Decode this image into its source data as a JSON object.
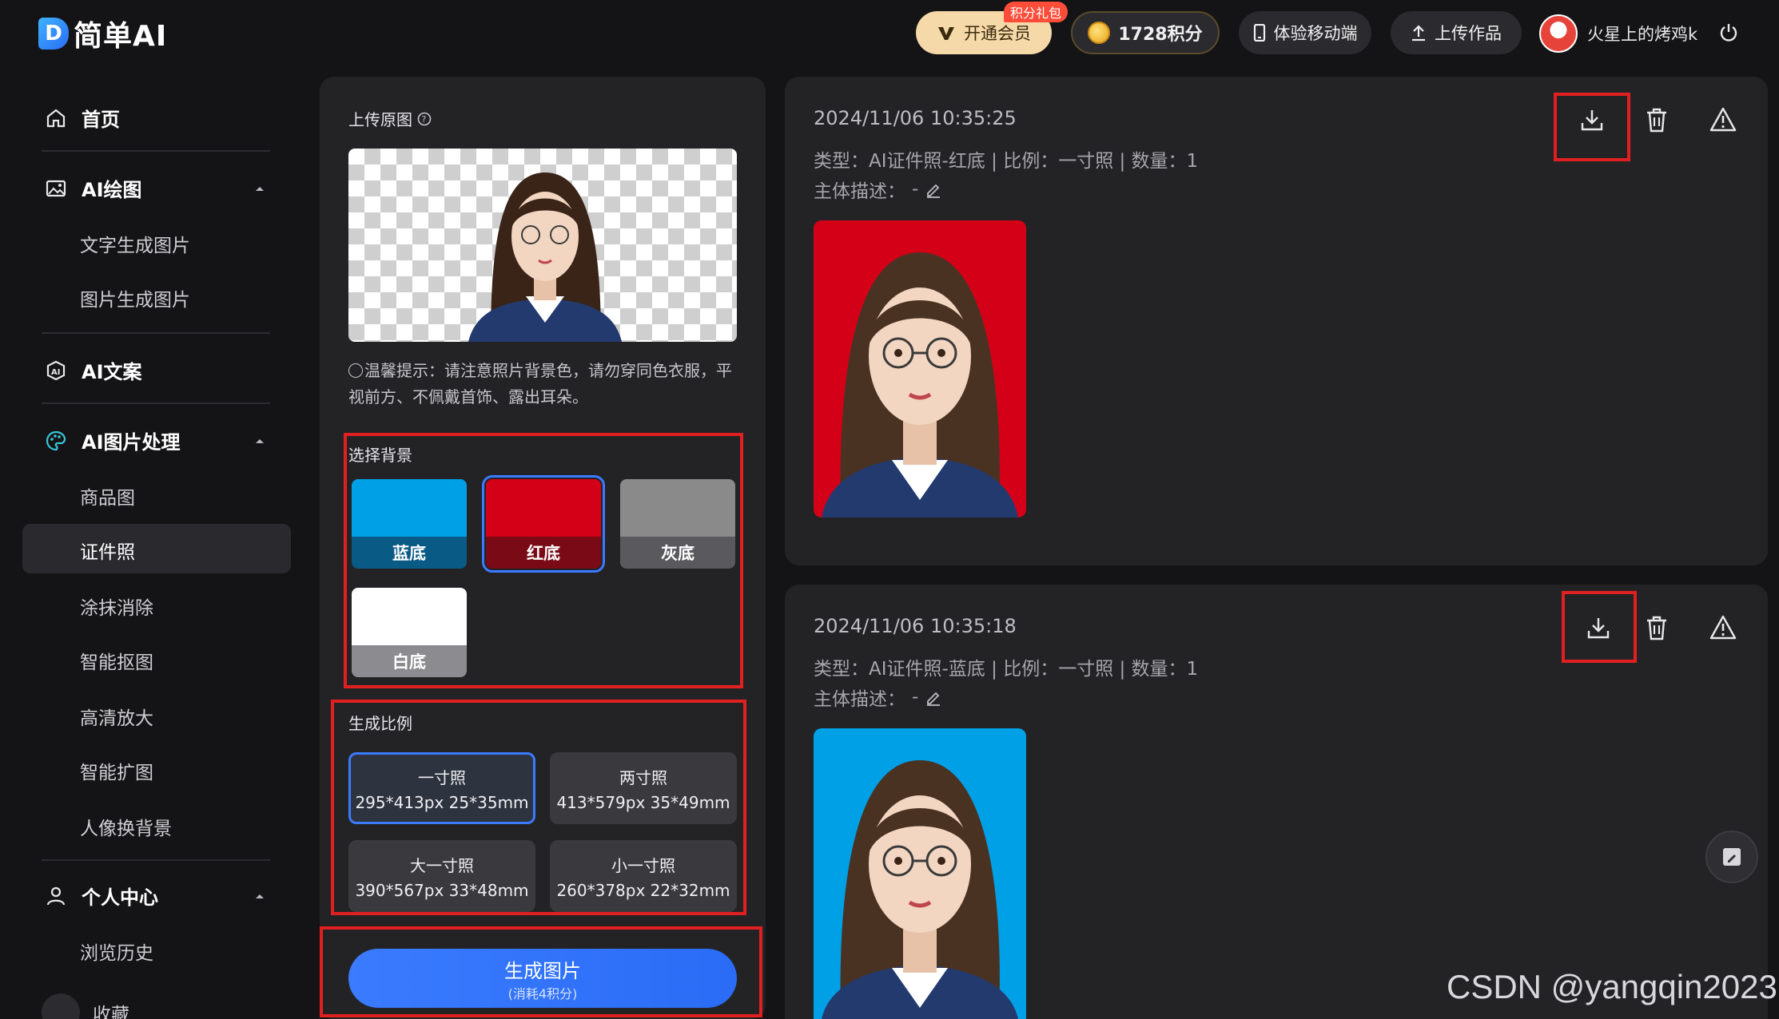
{
  "app": {
    "logo_letter": "D",
    "logo_text": "简单AI"
  },
  "topbar": {
    "vip_label": "开通会员",
    "vip_badge": "积分礼包",
    "points_label": "1728积分",
    "mobile_label": "体验移动端",
    "upload_label": "上传作品",
    "username": "火星上的烤鸡k"
  },
  "sidebar": {
    "home": "首页",
    "ai_draw": "AI绘图",
    "ai_draw_items": [
      "文字生成图片",
      "图片生成图片"
    ],
    "ai_copy": "AI文案",
    "ai_image": "AI图片处理",
    "ai_image_items": [
      "商品图",
      "证件照",
      "涂抹消除",
      "智能抠图",
      "高清放大",
      "智能扩图",
      "人像换背景"
    ],
    "personal": "个人中心",
    "personal_items": [
      "浏览历史",
      "收藏"
    ]
  },
  "panel": {
    "upload_title": "上传原图",
    "tip": "温馨提示：请注意照片背景色，请勿穿同色衣服，平视前方、不佩戴首饰、露出耳朵。",
    "bg_title": "选择背景",
    "backgrounds": [
      {
        "label": "蓝底",
        "color": "#00a0e6",
        "bar": "#0a5a86"
      },
      {
        "label": "红底",
        "color": "#d40018",
        "bar": "#7a0a16"
      },
      {
        "label": "灰底",
        "color": "#8a8a8a",
        "bar": "#5a5a5e"
      },
      {
        "label": "白底",
        "color": "#ffffff",
        "bar": "#8c8c90"
      }
    ],
    "ratio_title": "生成比例",
    "ratios": [
      {
        "name": "一寸照",
        "spec": "295*413px 25*35mm"
      },
      {
        "name": "两寸照",
        "spec": "413*579px 35*49mm"
      },
      {
        "name": "大一寸照",
        "spec": "390*567px 33*48mm"
      },
      {
        "name": "小一寸照",
        "spec": "260*378px 22*32mm"
      }
    ],
    "generate_label": "生成图片",
    "generate_cost": "(消耗4积分)"
  },
  "results": [
    {
      "time": "2024/11/06 10:35:25",
      "type": "类型：AI证件照-红底 | 比例：一寸照 | 数量：1",
      "desc_label": "主体描述：",
      "desc_value": "-",
      "bg": "#d40018"
    },
    {
      "time": "2024/11/06 10:35:18",
      "type": "类型：AI证件照-蓝底 | 比例：一寸照 | 数量：1",
      "desc_label": "主体描述：",
      "desc_value": "-",
      "bg": "#00a0e6"
    }
  ],
  "watermark": "CSDN @yangqin2023",
  "colors": {
    "accent": "#3b7bff",
    "highlight": "#e02020",
    "panel": "#232326",
    "bg": "#141416"
  }
}
